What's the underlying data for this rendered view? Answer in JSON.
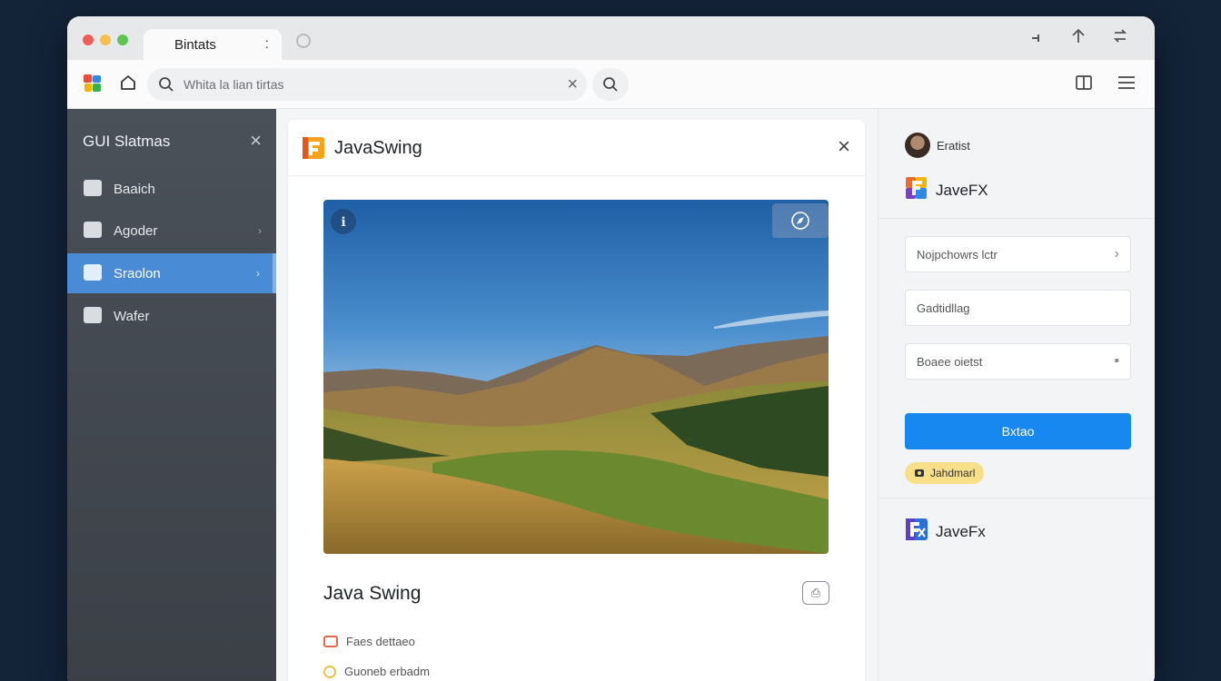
{
  "window": {
    "tab_title": "Bintats",
    "tab_more": ":",
    "traffic_colors": [
      "#ec5d57",
      "#f5bf4f",
      "#5fc454"
    ]
  },
  "toolbar": {
    "url_placeholder": "Whita la lian tirtas",
    "clear_symbol": "×"
  },
  "sidebar": {
    "title": "GUI Slatmas",
    "close_symbol": "×",
    "items": [
      {
        "label": "Baaich",
        "icon": "file-icon",
        "chevron": ""
      },
      {
        "label": "Agoder",
        "icon": "inbox-icon",
        "chevron": "›"
      },
      {
        "label": "Sraolon",
        "icon": "cloud-icon",
        "chevron": "›",
        "active": true
      },
      {
        "label": "Wafer",
        "icon": "save-icon",
        "chevron": ""
      }
    ]
  },
  "center": {
    "title": "JavaSwing",
    "close_symbol": "×",
    "hero_caption": "Java Swing",
    "action_symbol": "⎙",
    "meta": [
      {
        "label": "Faes dettaeo",
        "icon": "calendar-icon",
        "color": "#e8664a"
      },
      {
        "label": "Guoneb erbadm",
        "icon": "clock-icon",
        "color": "#f0c24a"
      }
    ]
  },
  "right": {
    "user_name": "Eratist",
    "app_top": "JaveFX",
    "fields": [
      {
        "label": "Nojpchowrs lctr",
        "icon": "›"
      },
      {
        "label": "Gadtidllag",
        "icon": ""
      },
      {
        "label": "Boaee oietst",
        "icon": "▪"
      }
    ],
    "primary_button": "Bxtao",
    "pill_label": "Jahdmarl",
    "app_bottom": "JaveFx"
  },
  "colors": {
    "accent_blue": "#1688f0",
    "sidebar_active": "#4a8bd6",
    "pill": "#f8e08a"
  }
}
